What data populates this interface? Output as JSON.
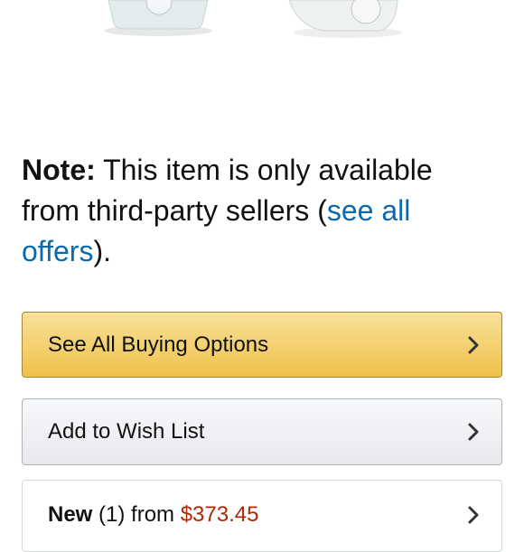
{
  "note": {
    "prefix": "Note:",
    "text": " This item is only available from third-party sellers (",
    "link": "see all offers",
    "suffix": ")."
  },
  "buttons": {
    "buy_options": "See All Buying Options",
    "wish_list": "Add to Wish List"
  },
  "offer": {
    "condition": "New",
    "count": " (1) from ",
    "price": "$373.45"
  },
  "colors": {
    "link": "#0a6ab0",
    "price": "#b12704",
    "buy_button": "#f0c14b"
  },
  "icons": {
    "chevron": "chevron-right-icon"
  }
}
